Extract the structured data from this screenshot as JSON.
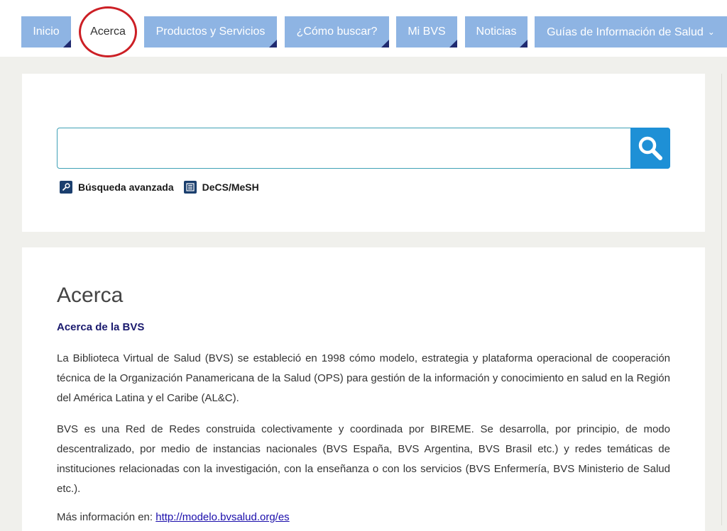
{
  "nav": {
    "tabs": [
      {
        "label": "Inicio"
      },
      {
        "label": "Acerca"
      },
      {
        "label": "Productos y Servicios"
      },
      {
        "label": "¿Cómo buscar?"
      },
      {
        "label": "Mi BVS"
      },
      {
        "label": "Noticias"
      },
      {
        "label": "Guías de Información de Salud",
        "chevron": "⌄"
      }
    ],
    "active": "Acerca"
  },
  "search": {
    "value": "",
    "placeholder": "",
    "button_icon": "search-icon",
    "links": [
      {
        "label": "Búsqueda avanzada",
        "icon": "key-icon"
      },
      {
        "label": "DeCS/MeSH",
        "icon": "list-book-icon"
      }
    ]
  },
  "content": {
    "title": "Acerca",
    "subtitle": "Acerca de la BVS",
    "paragraphs": [
      "La Biblioteca Virtual de Salud (BVS) se estableció en 1998 cómo modelo, estrategia y plataforma operacional de cooperación técnica de la Organización Panamericana de la Salud (OPS) para gestión de la información y conocimiento en salud en la Región del América Latina y el Caribe (AL&C).",
      "BVS es una Red de Redes construida colectivamente y coordinada por BIREME. Se desarrolla, por principio, de modo descentralizado, por medio de instancias nacionales (BVS España, BVS  Argentina, BVS Brasil etc.) y redes temáticas de instituciones relacionadas con la investigación, con la enseñanza o con los servicios (BVS Enfermería, BVS Ministerio de Salud etc.)."
    ],
    "more_prefix": "Más información en: ",
    "more_link": "http://modelo.bvsalud.org/es"
  },
  "colors": {
    "tab_bg": "#8eb4e3",
    "tab_corner": "#1f2a70",
    "search_button": "#1e90d6",
    "annotation_circle": "#cc1f25",
    "subtitle": "#1a1a6e"
  }
}
